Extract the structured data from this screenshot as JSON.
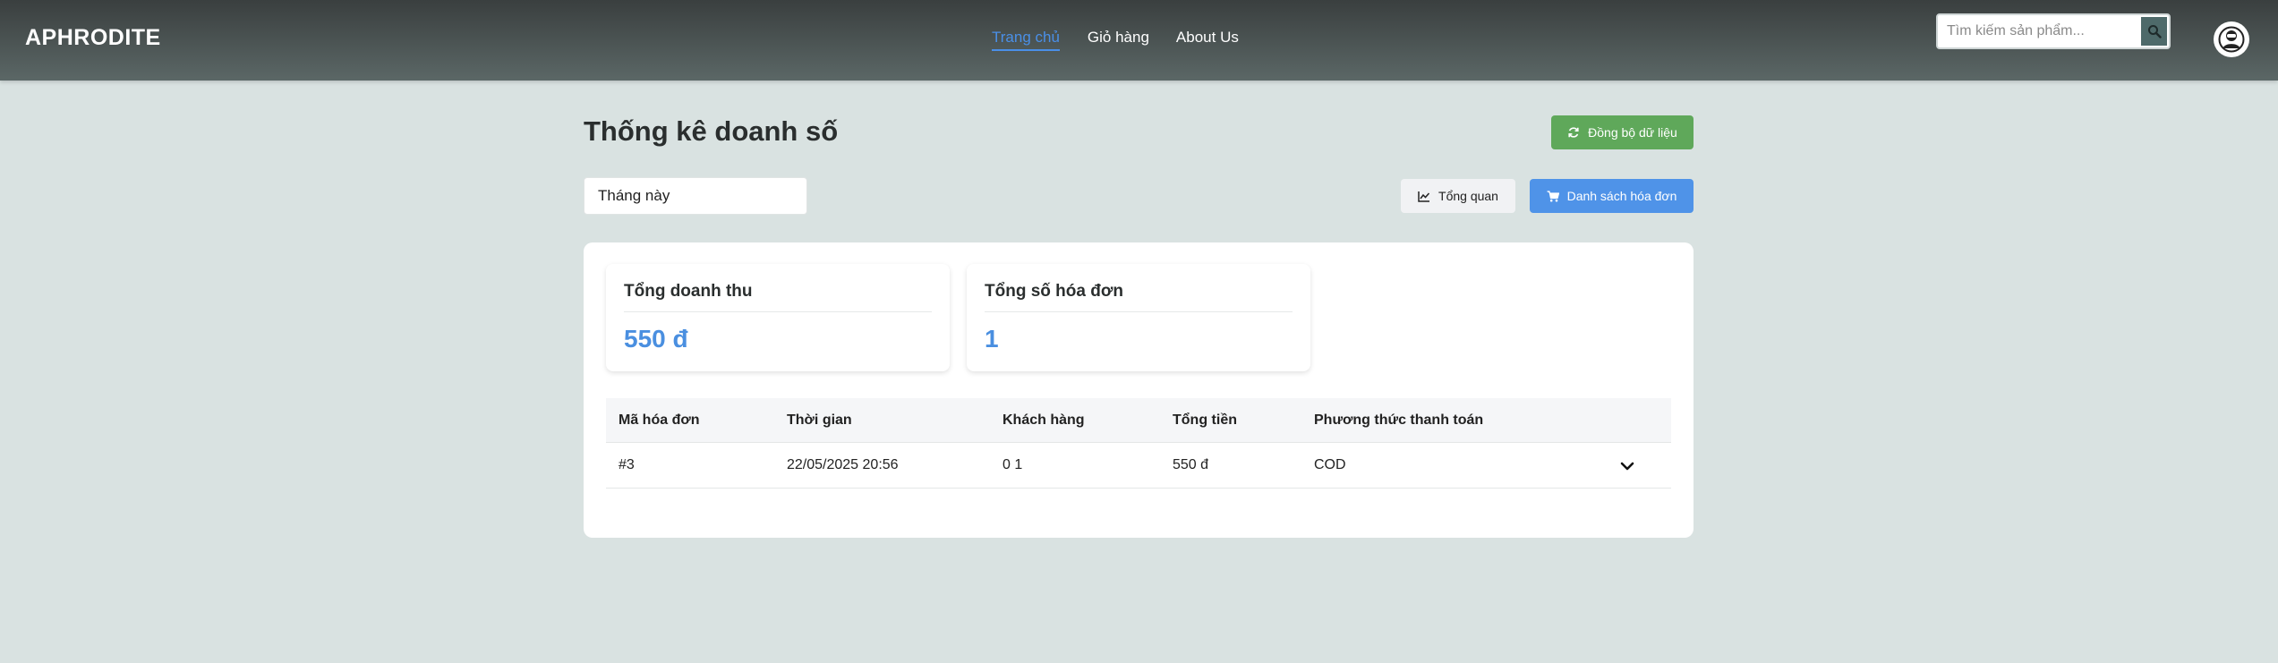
{
  "header": {
    "brand": "APHRODITE",
    "nav": {
      "home": "Trang chủ",
      "cart": "Giỏ hàng",
      "about": "About Us"
    },
    "search": {
      "placeholder": "Tìm kiếm sản phẩm...",
      "value": ""
    },
    "icons": [
      "search-icon",
      "user-avatar-icon"
    ],
    "active_nav_color": "#4a8fe7"
  },
  "page": {
    "title": "Thống kê doanh số",
    "sync_label": "Đồng bộ dữ liệu",
    "period_value": "Tháng này",
    "overview_label": "Tổng quan",
    "invoices_label": "Danh sách hóa đơn"
  },
  "stats": {
    "revenue_label": "Tổng doanh thu",
    "revenue_value": "550 đ",
    "count_label": "Tổng số hóa đơn",
    "count_value": "1"
  },
  "table": {
    "headers": [
      "Mã hóa đơn",
      "Thời gian",
      "Khách hàng",
      "Tổng tiền",
      "Phương thức thanh toán"
    ],
    "rows": [
      [
        "#3",
        "22/05/2025 20:56",
        "0 1",
        "550 đ",
        "COD"
      ]
    ]
  },
  "colors": {
    "sync_button": "#5fa85a",
    "invoices_button": "#4f93e8",
    "stat_value": "#4a8fe0",
    "background": "#d9e2e1"
  }
}
